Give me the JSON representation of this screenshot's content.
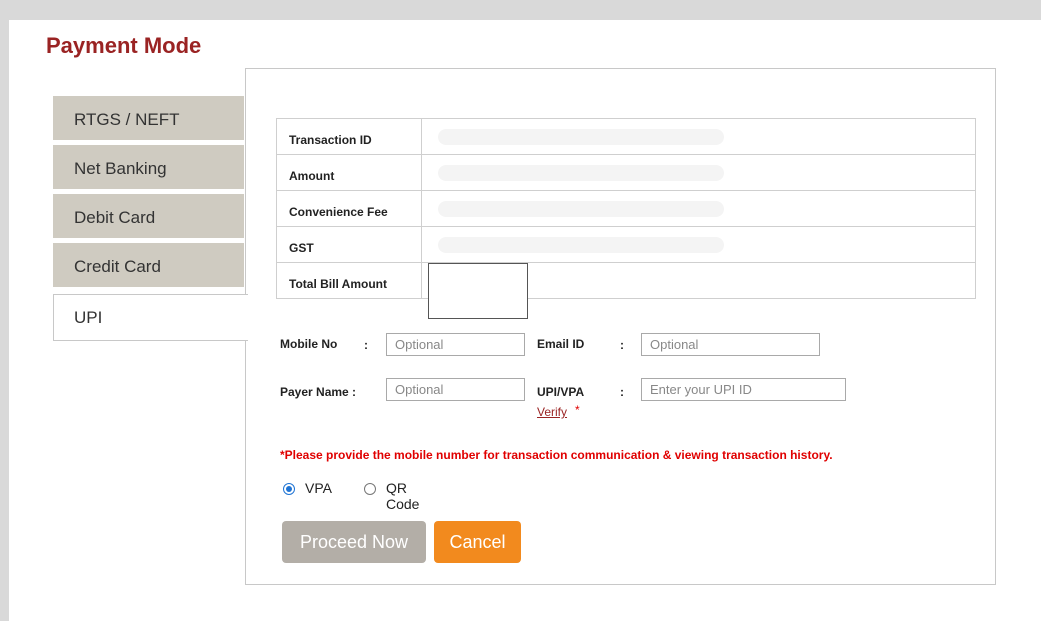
{
  "page": {
    "title": "Payment Mode"
  },
  "tabs": [
    {
      "label": "RTGS / NEFT"
    },
    {
      "label": "Net Banking"
    },
    {
      "label": "Debit Card"
    },
    {
      "label": "Credit Card"
    },
    {
      "label": "UPI",
      "active": true
    }
  ],
  "summary": {
    "rows": [
      {
        "label": "Transaction ID"
      },
      {
        "label": "Amount"
      },
      {
        "label": "Convenience Fee"
      },
      {
        "label": "GST"
      },
      {
        "label": "Total Bill Amount"
      }
    ]
  },
  "form": {
    "mobile": {
      "label": "Mobile No",
      "placeholder": "Optional"
    },
    "email": {
      "label": "Email ID",
      "placeholder": "Optional"
    },
    "payer": {
      "label": "Payer Name :",
      "placeholder": "Optional"
    },
    "upi": {
      "label": "UPI/VPA",
      "placeholder": "Enter your UPI ID"
    },
    "colon": ":",
    "verify_label": "Verify",
    "required_mark": "*"
  },
  "notice": "*Please provide the mobile number for transaction communication & viewing transaction history.",
  "payment_options": [
    {
      "label": "VPA",
      "selected": true
    },
    {
      "label": "QR Code",
      "selected": false
    }
  ],
  "buttons": {
    "proceed": "Proceed Now",
    "cancel": "Cancel"
  },
  "colors": {
    "title": "#9a2323",
    "tab_bg": "#cfcbc1",
    "notice": "#e00000",
    "cancel": "#f28a1e",
    "proceed_disabled": "#b3aea7",
    "radio_selected": "#1f74d4"
  }
}
